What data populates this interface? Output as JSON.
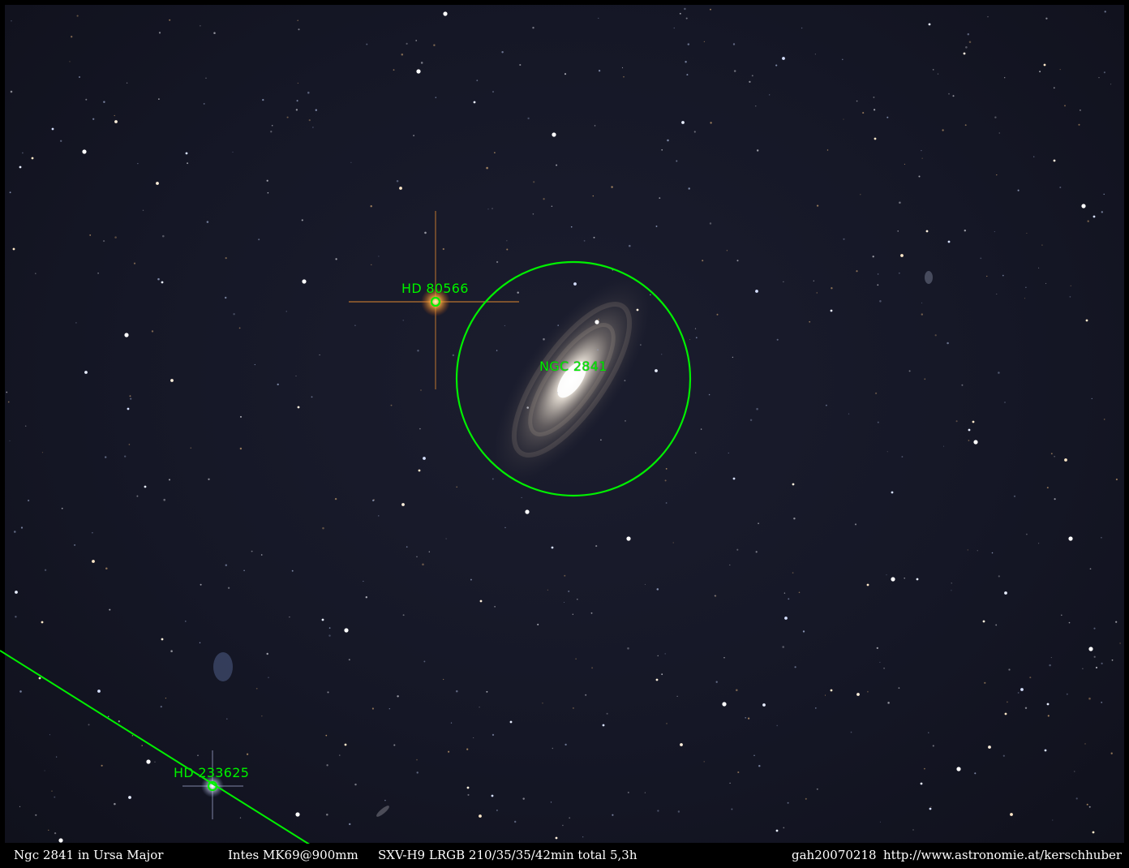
{
  "annotations": {
    "hd80566": "HD 80566",
    "ngc2841": "NGC 2841",
    "hd233625": "HD 233625"
  },
  "footer": {
    "title": "Ngc 2841 in Ursa Major",
    "telescope": "Intes MK69@900mm",
    "camera": "SXV-H9 LRGB 210/35/35/42min  total 5,3h",
    "id": "gah20070218",
    "url": "http://www.astronomie.at/kerschhuber"
  },
  "colors": {
    "annotation": "#00f000",
    "background": "#000000",
    "sky": "#171928"
  }
}
